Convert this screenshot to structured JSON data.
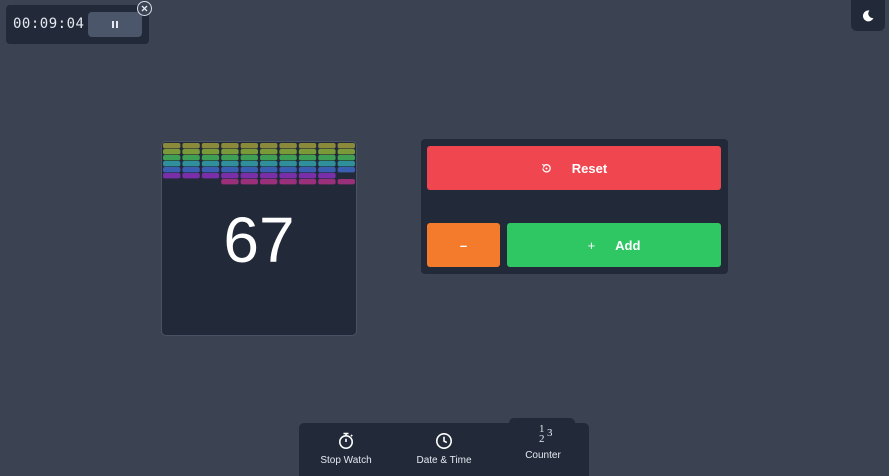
{
  "timer": {
    "time": "00:09:04",
    "pause_icon": "pause-icon",
    "close_icon": "close-icon"
  },
  "theme_toggle": {
    "icon": "moon-icon"
  },
  "counter": {
    "value": "67"
  },
  "controls": {
    "reset_label": "Reset",
    "reset_icon": "reset-icon",
    "minus_label": "–",
    "add_icon_glyph": "+",
    "add_label": "Add"
  },
  "nav": {
    "items": [
      {
        "label": "Stop Watch",
        "icon": "stopwatch-icon"
      },
      {
        "label": "Date & Time",
        "icon": "clock-icon"
      },
      {
        "label": "Counter",
        "icon": "numbers-icon",
        "active": true
      }
    ]
  },
  "colors": {
    "background": "#3b4252",
    "panel": "#222a3a",
    "reset": "#ef4650",
    "minus": "#f47b2c",
    "add": "#2ec764"
  }
}
